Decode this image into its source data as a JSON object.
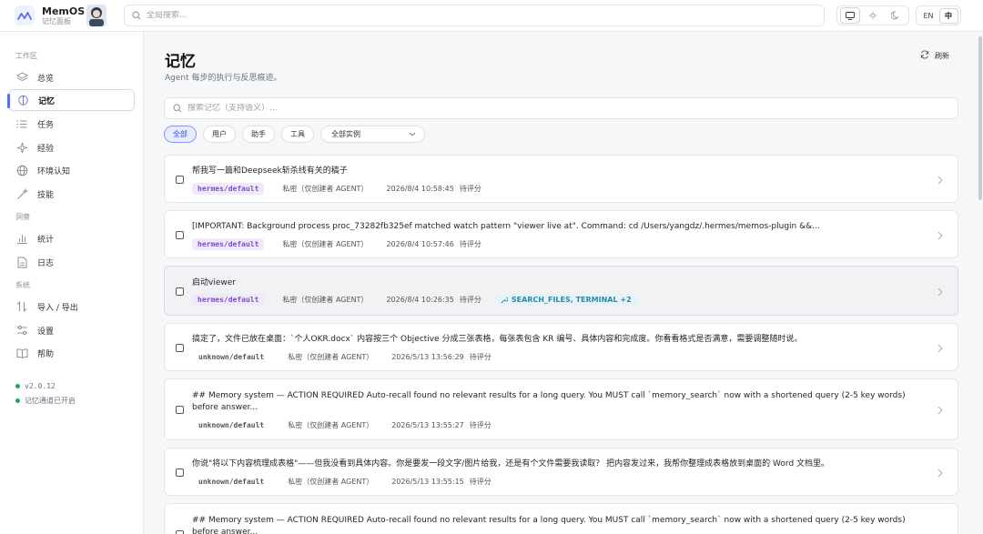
{
  "header": {
    "brand_name": "MemOS",
    "brand_sub": "记忆面板",
    "search_placeholder": "全局搜索...",
    "lang_en": "EN",
    "lang_zh": "中"
  },
  "sidebar": {
    "section_workspace": "工作区",
    "section_insight": "洞察",
    "section_system": "系统",
    "items": [
      {
        "label": "总览"
      },
      {
        "label": "记忆"
      },
      {
        "label": "任务"
      },
      {
        "label": "经验"
      },
      {
        "label": "环境认知"
      },
      {
        "label": "技能"
      },
      {
        "label": "统计"
      },
      {
        "label": "日志"
      },
      {
        "label": "导入 / 导出"
      },
      {
        "label": "设置"
      },
      {
        "label": "帮助"
      }
    ],
    "version": "v2.0.12",
    "status": "记忆通道已开启"
  },
  "main": {
    "title": "记忆",
    "subtitle": "Agent 每步的执行与反思痕迹。",
    "refresh": "刷新",
    "search_placeholder": "搜索记忆（支持语义）...",
    "filters": [
      "全部",
      "用户",
      "助手",
      "工具"
    ],
    "instance_select": "全部实例",
    "memories": [
      {
        "title": "帮我写一篇和Deepseek斩杀线有关的稿子",
        "tag": "hermes/default",
        "visibility": "私密（仅创建者 AGENT）",
        "time": "2026/8/4 10:58:45",
        "status": "待评分"
      },
      {
        "title": "[IMPORTANT: Background process proc_73282fb325ef matched watch pattern \"viewer live at\". Command: cd /Users/yangdz/.hermes/memos-plugin &&...",
        "tag": "hermes/default",
        "visibility": "私密（仅创建者 AGENT）",
        "time": "2026/8/4 10:57:46",
        "status": "待评分"
      },
      {
        "title": "启动viewer",
        "tag": "hermes/default",
        "visibility": "私密（仅创建者 AGENT）",
        "time": "2026/8/4 10:26:35",
        "status": "待评分",
        "tools": "SEARCH_FILES, TERMINAL +2"
      },
      {
        "title": "搞定了，文件已放在桌面：`个人OKR.docx` 内容按三个 Objective 分成三张表格，每张表包含 KR 编号、具体内容和完成度。你看看格式是否满意，需要调整随时说。",
        "tag": "unknown/default",
        "visibility": "私密（仅创建者 AGENT）",
        "time": "2026/5/13 13:56:29",
        "status": "待评分"
      },
      {
        "title": "## Memory system — ACTION REQUIRED Auto-recall found no relevant results for a long query. You MUST call `memory_search` now with a shortened query (2-5 key words) before answer...",
        "tag": "unknown/default",
        "visibility": "私密（仅创建者 AGENT）",
        "time": "2026/5/13 13:55:27",
        "status": "待评分"
      },
      {
        "title": "你说\"将以下内容梳理成表格\"——但我没看到具体内容。你是要发一段文字/图片给我，还是有个文件需要我读取？ 把内容发过来，我帮你整理成表格放到桌面的 Word 文档里。",
        "tag": "unknown/default",
        "visibility": "私密（仅创建者 AGENT）",
        "time": "2026/5/13 13:55:15",
        "status": "待评分"
      },
      {
        "title": "## Memory system — ACTION REQUIRED Auto-recall found no relevant results for a long query. You MUST call `memory_search` now with a shortened query (2-5 key words) before answer..."
      }
    ]
  }
}
